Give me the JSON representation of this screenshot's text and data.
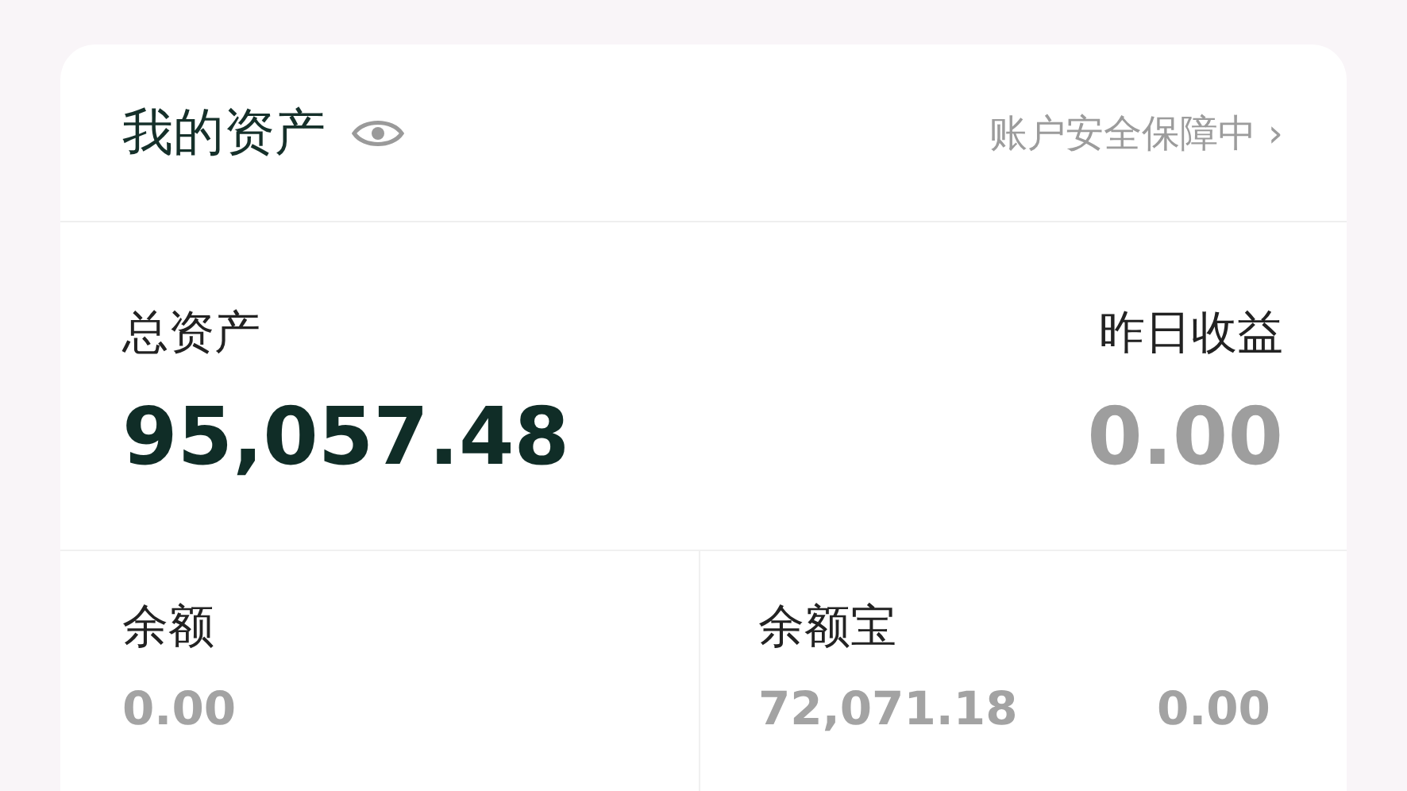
{
  "header": {
    "title": "我的资产",
    "security_link": "账户安全保障中 ›"
  },
  "summary": {
    "total_label": "总资产",
    "total_value": "95,057.48",
    "yesterday_label": "昨日收益",
    "yesterday_value": "0.00"
  },
  "accounts": [
    {
      "label": "余额",
      "values": [
        "0.00"
      ]
    },
    {
      "label": "余额宝",
      "values": [
        "72,071.18",
        "0.00"
      ]
    }
  ]
}
